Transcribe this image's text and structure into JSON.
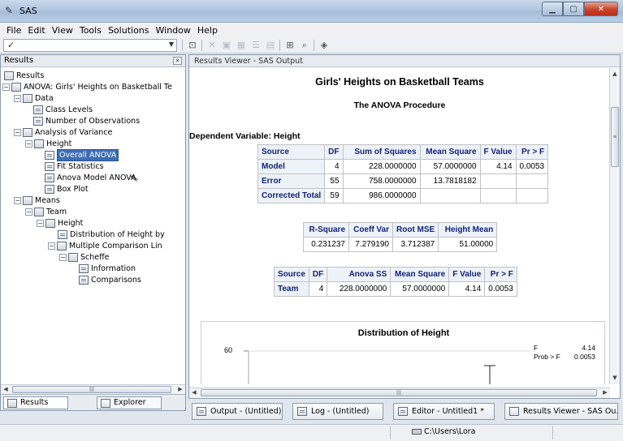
{
  "window": {
    "title": "SAS",
    "icon": "sas-app-icon"
  },
  "menu": [
    "File",
    "Edit",
    "View",
    "Tools",
    "Solutions",
    "Window",
    "Help"
  ],
  "toolbar": {
    "command_value": "✓"
  },
  "results_panel": {
    "title": "Results",
    "tree": {
      "root": "Results",
      "anova": "ANOVA:  Girls' Heights on Basketball Te",
      "data": "Data",
      "class_levels": "Class Levels",
      "num_obs": "Number of Observations",
      "analysis": "Analysis of Variance",
      "height": "Height",
      "overall_anova": "Overall ANOVA",
      "fit_stats": "Fit Statistics",
      "anova_model": "Anova Model ANOVA",
      "box_plot": "Box Plot",
      "means": "Means",
      "team": "Team",
      "height2": "Height",
      "distribution": "Distribution of Height by",
      "multiple_comparison": "Multiple Comparison Lin",
      "scheffe": "Scheffe",
      "information": "Information",
      "comparisons": "Comparisons"
    },
    "tabs": {
      "results": "Results",
      "explorer": "Explorer"
    }
  },
  "viewer": {
    "title": "Results Viewer - SAS Output",
    "heading": "Girls' Heights on Basketball Teams",
    "procedure": "The ANOVA Procedure",
    "dependent_variable": "Dependent Variable: Height",
    "anova_table": {
      "headers": [
        "Source",
        "DF",
        "Sum of Squares",
        "Mean Square",
        "F Value",
        "Pr > F"
      ],
      "rows": [
        [
          "Model",
          "4",
          "228.0000000",
          "57.0000000",
          "4.14",
          "0.0053"
        ],
        [
          "Error",
          "55",
          "758.0000000",
          "13.7818182",
          "",
          ""
        ],
        [
          "Corrected Total",
          "59",
          "986.0000000",
          "",
          "",
          ""
        ]
      ]
    },
    "fit_table": {
      "headers": [
        "R-Square",
        "Coeff Var",
        "Root MSE",
        "Height Mean"
      ],
      "row": [
        "0.231237",
        "7.279190",
        "3.712387",
        "51.00000"
      ]
    },
    "type_table": {
      "headers": [
        "Source",
        "DF",
        "Anova SS",
        "Mean Square",
        "F Value",
        "Pr > F"
      ],
      "row": [
        "Team",
        "4",
        "228.0000000",
        "57.0000000",
        "4.14",
        "0.0053"
      ]
    },
    "plot": {
      "title": "Distribution of Height",
      "ytick": "60",
      "inset_f_label": "F",
      "inset_f_value": "4.14",
      "inset_p_label": "Prob > F",
      "inset_p_value": "0.0053"
    }
  },
  "tasks": [
    "Output - (Untitled)",
    "Log - (Untitled)",
    "Editor - Untitled1 *",
    "Results Viewer - SAS Ou..."
  ],
  "status": {
    "path": "C:\\Users\\Lora"
  }
}
